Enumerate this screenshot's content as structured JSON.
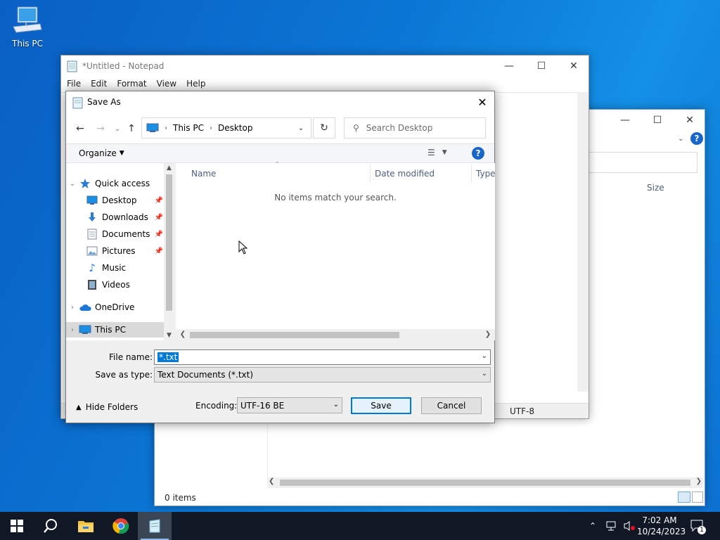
{
  "desktop": {
    "icons": [
      {
        "label": "This PC"
      }
    ]
  },
  "explorer": {
    "status": "0 items",
    "size_header": "Size"
  },
  "notepad": {
    "title": "*Untitled - Notepad",
    "menu": [
      "File",
      "Edit",
      "Format",
      "View",
      "Help"
    ],
    "encoding": "UTF-8"
  },
  "dialog": {
    "title": "Save As",
    "breadcrumb": [
      "This PC",
      "Desktop"
    ],
    "search_placeholder": "Search Desktop",
    "organize_label": "Organize",
    "nav_items": [
      {
        "label": "Quick access",
        "icon": "star-icon",
        "pinned": false
      },
      {
        "label": "Desktop",
        "icon": "desktop-icon",
        "pinned": true
      },
      {
        "label": "Downloads",
        "icon": "download-icon",
        "pinned": true
      },
      {
        "label": "Documents",
        "icon": "document-icon",
        "pinned": true
      },
      {
        "label": "Pictures",
        "icon": "pictures-icon",
        "pinned": true
      },
      {
        "label": "Music",
        "icon": "music-icon",
        "pinned": false
      },
      {
        "label": "Videos",
        "icon": "videos-icon",
        "pinned": false
      },
      {
        "label": "OneDrive",
        "icon": "cloud-icon",
        "pinned": false
      },
      {
        "label": "This PC",
        "icon": "computer-icon",
        "pinned": false
      }
    ],
    "columns": [
      "Name",
      "Date modified",
      "Type"
    ],
    "empty_message": "No items match your search.",
    "file_name_label": "File name:",
    "file_name_value": "*.txt",
    "save_type_label": "Save as type:",
    "save_type_value": "Text Documents (*.txt)",
    "hide_folders_label": "Hide Folders",
    "encoding_label": "Encoding:",
    "encoding_value": "UTF-16 BE",
    "save_label": "Save",
    "cancel_label": "Cancel"
  },
  "taskbar": {
    "time": "7:02 AM",
    "date": "10/24/2023",
    "notification_count": "1"
  },
  "colors": {
    "accent": "#0078d7",
    "taskbar": "#101826",
    "desktop": "#0b78d6"
  }
}
